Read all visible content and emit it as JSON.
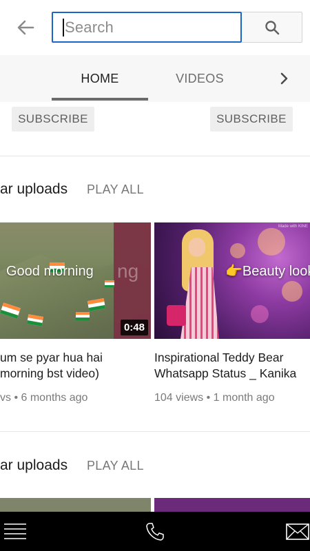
{
  "search": {
    "placeholder": "Search"
  },
  "tabs": [
    {
      "label": "HOME",
      "selected": true
    },
    {
      "label": "VIDEOS",
      "selected": false
    }
  ],
  "subscribe": {
    "left_label": "SUBSCRIBE",
    "right_label": "SUBSCRIBE"
  },
  "shelves": [
    {
      "title": "ar uploads",
      "play_all": "PLAY ALL",
      "videos": [
        {
          "thumb_text": "Good morning",
          "duration": "0:48",
          "title_line1": "um se pyar hua hai",
          "title_line2": "morning bst video)",
          "meta": "vs • 6 months ago"
        },
        {
          "thumb_text": "Beauty look",
          "watermark": "Made with KINE",
          "title_line1": "Inspirational Teddy Bear",
          "title_line2": "Whatsapp Status _ Kanika",
          "meta": "104 views • 1 month ago"
        }
      ]
    },
    {
      "title": "ar uploads",
      "play_all": "PLAY ALL"
    }
  ],
  "icons": {
    "back": "arrow-left-icon",
    "search": "search-icon",
    "tabs_next": "chevron-right-icon",
    "nav_menu": "hamburger-menu-icon",
    "nav_phone": "phone-icon",
    "nav_mail": "mail-icon"
  },
  "colors": {
    "search_focus": "#1a66c4",
    "tab_bar_bg": "#f7f7f7",
    "subscribe_bg": "#eeeeee",
    "nav_bg": "#000000"
  }
}
